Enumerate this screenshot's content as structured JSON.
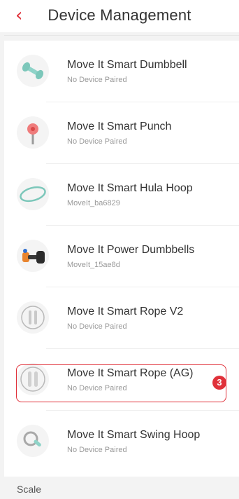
{
  "header": {
    "title": "Device Management",
    "back_icon": "chevron-left-icon"
  },
  "devices": [
    {
      "name": "Move It Smart Dumbbell",
      "status": "No Device Paired",
      "icon": "dumbbell-icon"
    },
    {
      "name": "Move It Smart Punch",
      "status": "No Device Paired",
      "icon": "punch-icon"
    },
    {
      "name": "Move It Smart Hula Hoop",
      "status": "MoveIt_ba6829",
      "icon": "hula-hoop-icon"
    },
    {
      "name": "Move It Power Dumbbells",
      "status": "MoveIt_15ae8d",
      "icon": "power-dumbbells-icon"
    },
    {
      "name": "Move It Smart Rope V2",
      "status": "No Device Paired",
      "icon": "rope-v2-icon"
    },
    {
      "name": "Move It Smart Rope (AG)",
      "status": "No Device Paired",
      "icon": "rope-ag-icon"
    },
    {
      "name": "Move It Smart Swing Hoop",
      "status": "No Device Paired",
      "icon": "swing-hoop-icon"
    }
  ],
  "annotation": {
    "badge": "3"
  },
  "section": {
    "label": "Scale"
  },
  "colors": {
    "accent": "#e0313a",
    "text": "#333333",
    "subtext": "#9a9a9a"
  }
}
